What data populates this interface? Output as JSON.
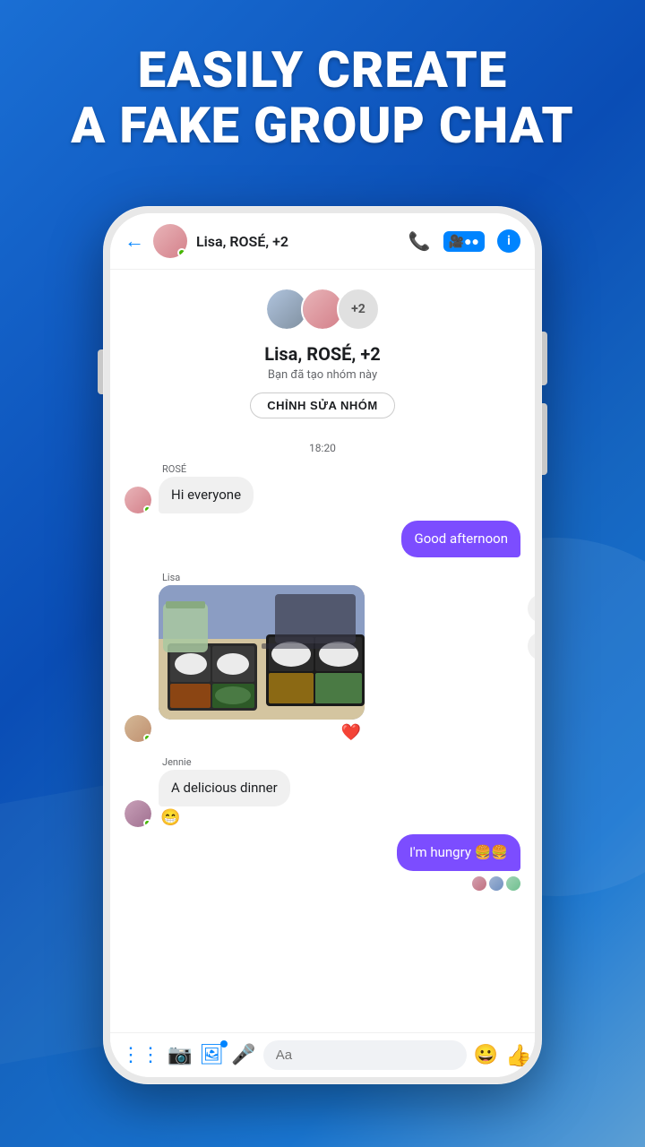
{
  "header": {
    "title": "EASILY CREATE\nA FAKE GROUP CHAT"
  },
  "messenger": {
    "back_icon": "←",
    "group_name": "Lisa, ROSÉ, +2",
    "group_name_full": "Lisa, ROSÉ, +2",
    "group_subtitle": "Bạn đã tạo nhóm này",
    "edit_group_btn": "CHỈNH SỬA NHÓM",
    "time_separator": "18:20",
    "messages": [
      {
        "sender": "ROSÉ",
        "text": "Hi everyone",
        "direction": "left"
      },
      {
        "sender": "",
        "text": "Good afternoon",
        "direction": "right"
      },
      {
        "sender": "Lisa",
        "text": "[image]",
        "direction": "left"
      },
      {
        "sender": "Jennie",
        "text": "A delicious dinner",
        "direction": "left"
      },
      {
        "sender": "",
        "text": "I'm hungry 🍔🍔",
        "direction": "right"
      }
    ],
    "heart_reaction": "❤️",
    "emoji_reaction": "😁",
    "toolbar": {
      "placeholder": "Aa",
      "icons": [
        "dots-grid",
        "camera",
        "photo-gallery",
        "microphone"
      ],
      "right_icons": [
        "emoji",
        "thumbs-up"
      ]
    }
  }
}
